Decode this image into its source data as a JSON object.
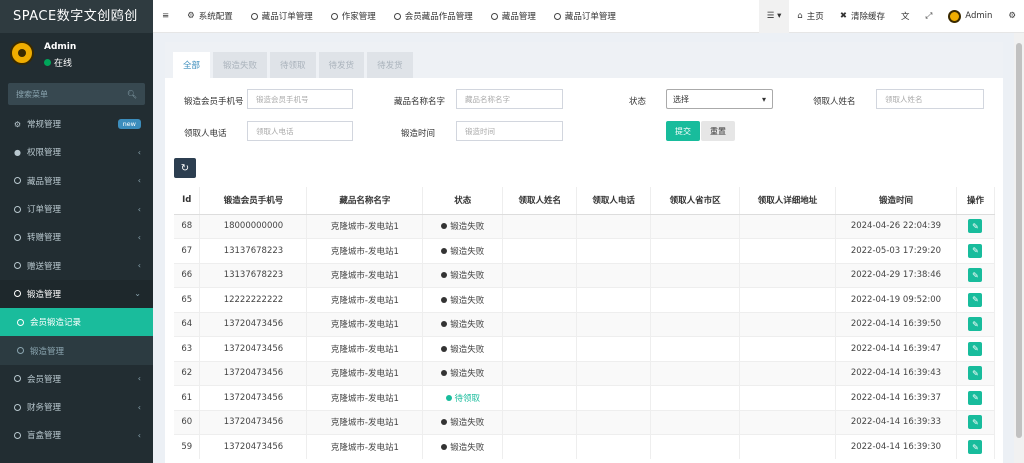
{
  "brand": "SPACE数字文创鸥创",
  "user": {
    "name": "Admin",
    "status": "在线"
  },
  "search": {
    "placeholder": "搜索菜单"
  },
  "menu": [
    {
      "label": "常规管理",
      "icon": "gears-icon",
      "badge": "new"
    },
    {
      "label": "权限管理",
      "icon": "users-icon"
    },
    {
      "label": "藏品管理",
      "icon": "circle-icon"
    },
    {
      "label": "订单管理",
      "icon": "circle-icon"
    },
    {
      "label": "转赠管理",
      "icon": "circle-icon"
    },
    {
      "label": "赠送管理",
      "icon": "circle-icon"
    },
    {
      "label": "锻造管理",
      "icon": "circle-icon"
    },
    {
      "label": "会员锻造记录",
      "icon": "circle-icon"
    },
    {
      "label": "锻造管理",
      "icon": "circle-icon"
    },
    {
      "label": "会员管理",
      "icon": "circle-icon"
    },
    {
      "label": "财务管理",
      "icon": "circle-icon"
    },
    {
      "label": "盲盒管理",
      "icon": "circle-icon"
    }
  ],
  "topnav": {
    "items": [
      "系统配置",
      "藏品订单管理",
      "作家管理",
      "会员藏品作品管理",
      "藏品管理",
      "藏品订单管理"
    ],
    "home": "主页",
    "clear_cache": "清除缓存",
    "admin": "Admin"
  },
  "tabs": [
    "全部",
    "锻造失败",
    "待领取",
    "待发货",
    "待发货"
  ],
  "filters": {
    "phone_label": "锻造会员手机号",
    "phone_placeholder": "锻造会员手机号",
    "name_label": "藏品名称名字",
    "name_placeholder": "藏品名称名字",
    "status_label": "状态",
    "status_value": "选择",
    "receiver_label": "领取人姓名",
    "receiver_placeholder": "领取人姓名",
    "rphone_label": "领取人电话",
    "rphone_placeholder": "领取人电话",
    "time_label": "锻造时间",
    "time_placeholder": "锻造时间",
    "submit": "提交",
    "reset": "重置"
  },
  "table": {
    "headers": [
      "Id",
      "锻造会员手机号",
      "藏品名称名字",
      "状态",
      "领取人姓名",
      "领取人电话",
      "领取人省市区",
      "领取人详细地址",
      "锻造时间",
      "操作"
    ],
    "rows": [
      [
        "68",
        "18000000000",
        "克隆城市-发电站1",
        "锻造失败",
        "2024-04-26 22:04:39"
      ],
      [
        "67",
        "13137678223",
        "克隆城市-发电站1",
        "锻造失败",
        "2022-05-03 17:29:20"
      ],
      [
        "66",
        "13137678223",
        "克隆城市-发电站1",
        "锻造失败",
        "2022-04-29 17:38:46"
      ],
      [
        "65",
        "12222222222",
        "克隆城市-发电站1",
        "锻造失败",
        "2022-04-19 09:52:00"
      ],
      [
        "64",
        "13720473456",
        "克隆城市-发电站1",
        "锻造失败",
        "2022-04-14 16:39:50"
      ],
      [
        "63",
        "13720473456",
        "克隆城市-发电站1",
        "锻造失败",
        "2022-04-14 16:39:47"
      ],
      [
        "62",
        "13720473456",
        "克隆城市-发电站1",
        "锻造失败",
        "2022-04-14 16:39:43"
      ],
      [
        "61",
        "13720473456",
        "克隆城市-发电站1",
        "待领取",
        "2022-04-14 16:39:37"
      ],
      [
        "60",
        "13720473456",
        "克隆城市-发电站1",
        "锻造失败",
        "2022-04-14 16:39:33"
      ],
      [
        "59",
        "13720473456",
        "克隆城市-发电站1",
        "锻造失败",
        "2022-04-14 16:39:30"
      ]
    ]
  },
  "colors": {
    "accent": "#18bc9c",
    "sidebar": "#222d32",
    "fail": "#333333",
    "pending": "#18bc9c"
  }
}
